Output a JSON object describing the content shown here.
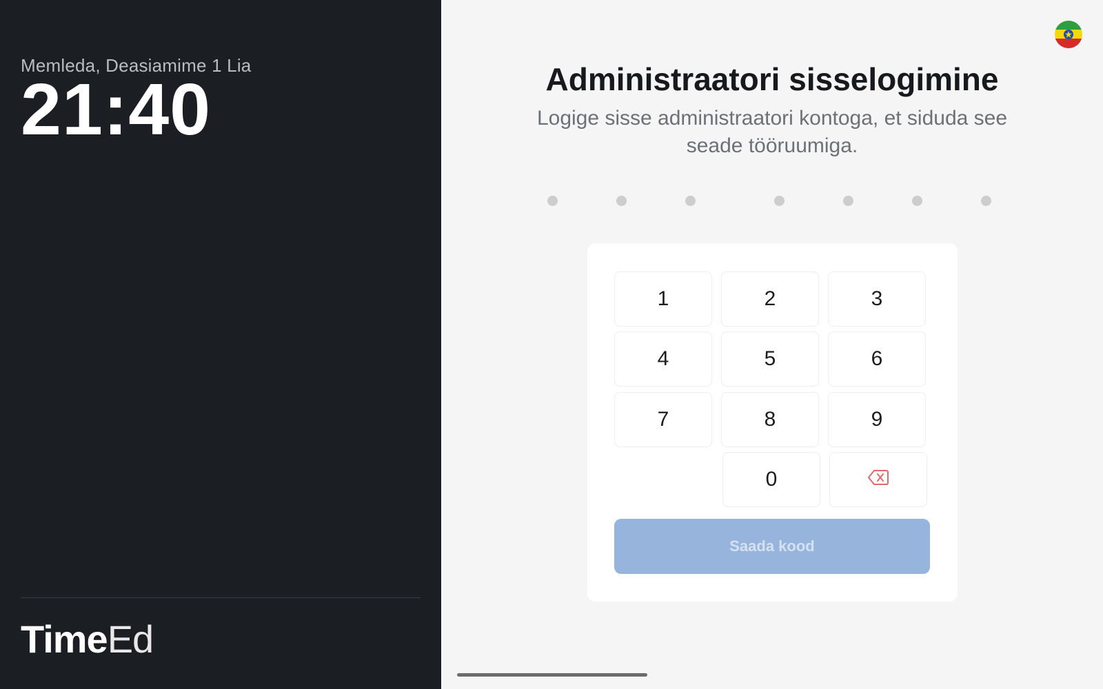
{
  "clock_panel": {
    "date": "Memleda, Deasiamime 1 Lia",
    "time": "21:40"
  },
  "brand": {
    "logo_bold": "Time",
    "logo_thin": "Ed"
  },
  "login": {
    "title": "Administraatori sisselogimine",
    "subtitle": "Logige sisse administraatori kontoga, et siduda see seade tööruumiga.",
    "code_length": 7,
    "keypad": {
      "keys": [
        "1",
        "2",
        "3",
        "4",
        "5",
        "6",
        "7",
        "8",
        "9",
        "0"
      ],
      "backspace_icon": "backspace-icon"
    },
    "send_button": "Saada kood"
  },
  "language": {
    "flag_icon": "flag-icon"
  },
  "colors": {
    "left_panel_bg": "#1b1e22",
    "right_panel_bg": "#f5f5f6",
    "send_button_bg": "#96b4dc",
    "backspace_color": "#e36a6a"
  }
}
